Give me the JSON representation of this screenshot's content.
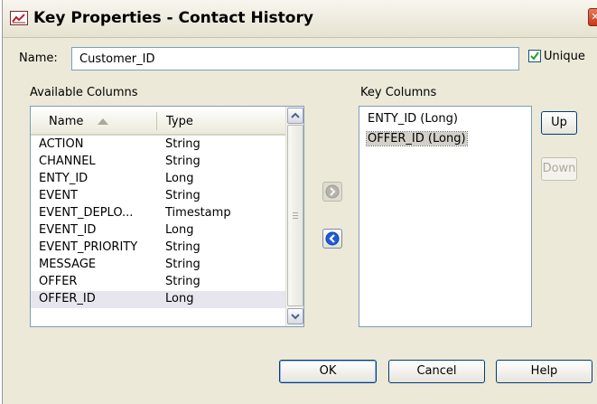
{
  "window": {
    "title": "Key Properties - Contact History",
    "close_glyph": "✕"
  },
  "name_field": {
    "label": "Name:",
    "value": "Customer_ID"
  },
  "unique": {
    "label": "Unique",
    "checked": true
  },
  "available_columns": {
    "label": "Available Columns",
    "headers": {
      "name": "Name",
      "type": "Type"
    },
    "sort": "ascending",
    "rows": [
      {
        "name": "ACTION",
        "type": "String"
      },
      {
        "name": "CHANNEL",
        "type": "String"
      },
      {
        "name": "ENTY_ID",
        "type": "Long"
      },
      {
        "name": "EVENT",
        "type": "String"
      },
      {
        "name": "EVENT_DEPLO...",
        "type": "Timestamp"
      },
      {
        "name": "EVENT_ID",
        "type": "Long"
      },
      {
        "name": "EVENT_PRIORITY",
        "type": "String"
      },
      {
        "name": "MESSAGE",
        "type": "String"
      },
      {
        "name": "OFFER",
        "type": "String"
      },
      {
        "name": "OFFER_ID",
        "type": "Long"
      }
    ],
    "selected_row": "OFFER_ID"
  },
  "key_columns": {
    "label": "Key Columns",
    "items": [
      "ENTY_ID (Long)",
      "OFFER_ID (Long)"
    ],
    "selected_item": "OFFER_ID (Long)"
  },
  "buttons": {
    "up": "Up",
    "down": "Down",
    "ok": "OK",
    "cancel": "Cancel",
    "help": "Help"
  },
  "icons": {
    "app": "chart-icon",
    "add": "arrow-right-icon",
    "remove": "arrow-left-icon",
    "close": "close-icon"
  },
  "colors": {
    "dialog_background": "#ece9d8",
    "arrow_blue": "#1f5bd6",
    "disabled_text": "#acaa99"
  }
}
